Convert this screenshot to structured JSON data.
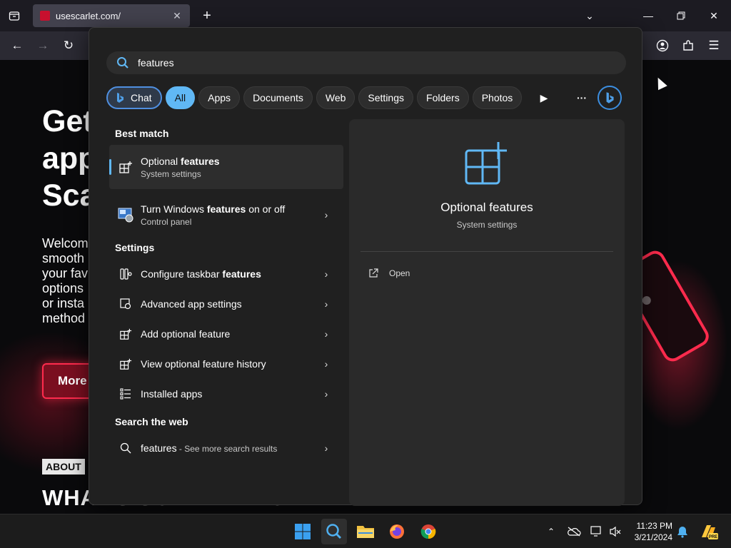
{
  "browser": {
    "tab_title": "usescarlet.com/",
    "new_tab": "+",
    "window_controls": [
      "minimize-icon",
      "restore-icon",
      "close-icon"
    ]
  },
  "page": {
    "hero_line1": "Get",
    "hero_line2": "app",
    "hero_line3": "Sca",
    "desc_line1": "Welcom",
    "desc_line2": "smooth",
    "desc_line3": "your fav",
    "desc_line4": "options",
    "desc_line5": "or insta",
    "desc_line6": "method",
    "more_button": "More",
    "about_tag": "ABOUT",
    "section_title": "WHAT'S SCARLET? GET"
  },
  "search": {
    "query": "features",
    "filters": [
      "Chat",
      "All",
      "Apps",
      "Documents",
      "Web",
      "Settings",
      "Folders",
      "Photos"
    ],
    "active_filter": "All",
    "best_match_label": "Best match",
    "settings_label": "Settings",
    "web_label": "Search the web",
    "best": {
      "title_pre": "Optional ",
      "title_bold": "features",
      "subtitle": "System settings"
    },
    "apps": [
      {
        "title_pre": "Turn Windows ",
        "title_bold": "features",
        "title_post": " on or off",
        "subtitle": "Control panel"
      }
    ],
    "settings": [
      {
        "title_pre": "Configure taskbar ",
        "title_bold": "features"
      },
      {
        "title_pre": "Advanced app settings",
        "title_bold": ""
      },
      {
        "title_pre": "Add optional feature",
        "title_bold": ""
      },
      {
        "title_pre": "View optional feature history",
        "title_bold": ""
      },
      {
        "title_pre": "Installed apps",
        "title_bold": ""
      }
    ],
    "web": {
      "query": "features",
      "suffix": " - See more search results"
    },
    "preview": {
      "title": "Optional features",
      "subtitle": "System settings",
      "action": "Open"
    }
  },
  "taskbar": {
    "time": "11:23 PM",
    "date": "3/21/2024",
    "badge": "PRE"
  },
  "colors": {
    "accent": "#60b8f5",
    "panel_bg": "#202020",
    "scarlet": "#ff2b4d"
  }
}
